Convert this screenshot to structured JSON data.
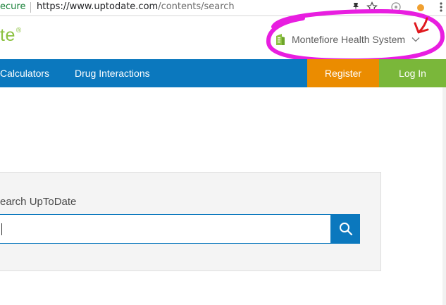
{
  "browser": {
    "secure_text": "ecure",
    "url_host": "https://www.uptodate.com",
    "url_path": "/contents/search"
  },
  "header": {
    "brand_text": "te",
    "brand_reg": "®",
    "organization": "Montefiore Health System"
  },
  "nav": {
    "items": [
      {
        "label": "Calculators"
      },
      {
        "label": "Drug Interactions"
      }
    ],
    "register_label": "Register",
    "login_label": "Log In"
  },
  "search": {
    "title": "earch UpToDate",
    "value": ""
  },
  "colors": {
    "nav_blue": "#0b78be",
    "register_orange": "#eb8c00",
    "login_green": "#7ab73a",
    "brand_green": "#8bc13f",
    "annotation_magenta": "#e81ee0",
    "annotation_red": "#e0191f"
  },
  "icons": {
    "org": "building-icon",
    "dropdown": "chevron-down-icon",
    "search": "search-icon"
  }
}
